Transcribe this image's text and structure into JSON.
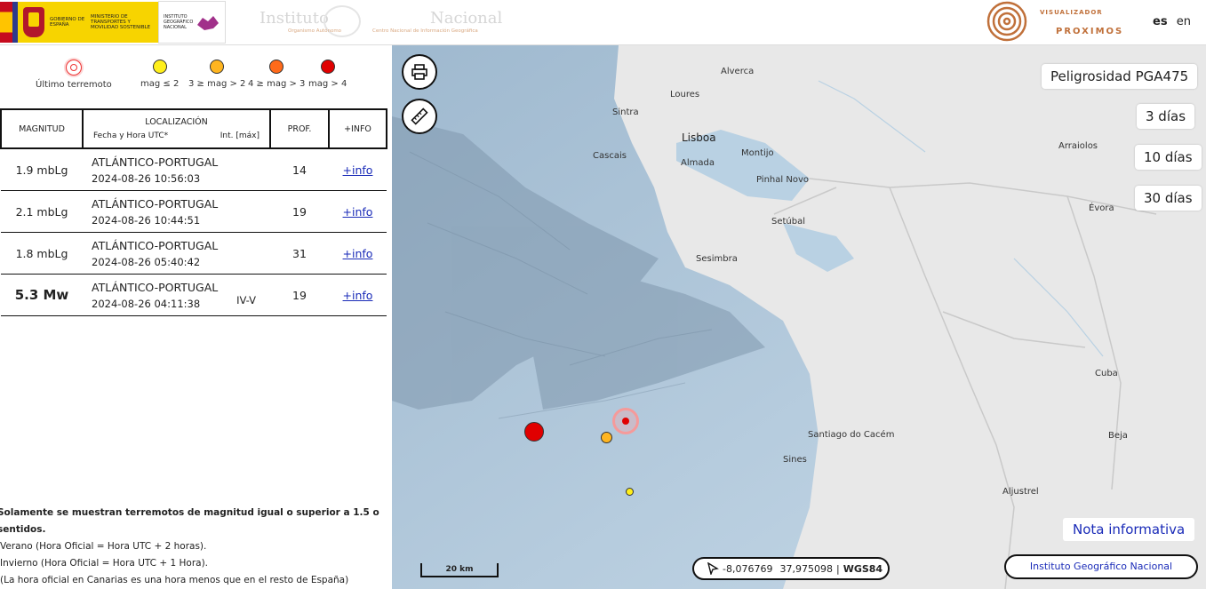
{
  "header": {
    "gobierno_text": "GOBIERNO DE ESPAÑA",
    "ministerio_text": "MINISTERIO DE TRANSPORTES Y MOVILIDAD SOSTENIBLE",
    "ign_small_text": "INSTITUTO GEOGRÁFICO NACIONAL",
    "instituto_title": "Instituto",
    "instituto_sub": "Organismo Autónomo",
    "nacional_title": "Nacional",
    "cnig_sub": "Centro Nacional de Información Geográfica",
    "visualizador": "VISUALIZADOR",
    "proximos": "PROXIMOS",
    "lang_es": "es",
    "lang_en": "en"
  },
  "legend": {
    "last": "Último terremoto",
    "items": [
      {
        "label": "mag ≤ 2",
        "color": "#ffef1a"
      },
      {
        "label": "3 ≥ mag > 2",
        "color": "#ffb520"
      },
      {
        "label": "4 ≥ mag > 3",
        "color": "#ff6a1a"
      },
      {
        "label": "mag > 4",
        "color": "#e00000"
      }
    ]
  },
  "table": {
    "headers": {
      "magnitud": "MAGNITUD",
      "localizacion": "LOCALIZACIÓN",
      "fecha": "Fecha y Hora UTC*",
      "int": "Int. [máx]",
      "prof": "PROF.",
      "info": "+INFO"
    },
    "rows": [
      {
        "mag": "1.9 mbLg",
        "place": "ATLÁNTICO-PORTUGAL",
        "time": "2024-08-26 10:56:03",
        "int": "",
        "prof": "14",
        "info": "+info"
      },
      {
        "mag": "2.1 mbLg",
        "place": "ATLÁNTICO-PORTUGAL",
        "time": "2024-08-26 10:44:51",
        "int": "",
        "prof": "19",
        "info": "+info"
      },
      {
        "mag": "1.8 mbLg",
        "place": "ATLÁNTICO-PORTUGAL",
        "time": "2024-08-26 05:40:42",
        "int": "",
        "prof": "31",
        "info": "+info"
      },
      {
        "mag": "5.3 Mw",
        "place": "ATLÁNTICO-PORTUGAL",
        "time": "2024-08-26 04:11:38",
        "int": "IV-V",
        "prof": "19",
        "info": "+info"
      }
    ]
  },
  "notes": {
    "n0": "Solamente se muestran terremotos de magnitud igual o superior a 1.5 o sentidos.",
    "n1": "Verano (Hora Oficial = Hora UTC + 2 horas).",
    "n2": "Invierno (Hora Oficial = Hora UTC + 1 Hora).",
    "n3": "(La hora oficial en Canarias es una hora menos que en el resto de España)"
  },
  "map": {
    "peligrosidad": "Peligrosidad PGA475",
    "dias3": "3 días",
    "dias10": "10 días",
    "dias30": "30 días",
    "nota": "Nota informativa",
    "scale": "20 km",
    "lon": "-8,076769",
    "lat": "37,975098",
    "datum": "WGS84",
    "ign_link": "Instituto Geográfico Nacional",
    "cities": {
      "alverca": "Alverca",
      "loures": "Loures",
      "sintra": "Sintra",
      "lisboa": "Lisboa",
      "cascais": "Cascais",
      "almada": "Almada",
      "montijo": "Montijo",
      "pinhal": "Pinhal Novo",
      "arraiolos": "Arraiolos",
      "evora": "Évora",
      "setubal": "Setúbal",
      "sesimbra": "Sesimbra",
      "cuba": "Cuba",
      "santiago": "Santiago do Cacém",
      "beja": "Beja",
      "sines": "Sines",
      "aljustrel": "Aljustrel"
    },
    "colors": {
      "sea": "#b8cfe0",
      "land": "#e6e6e6",
      "accent": "#1a2bb8"
    }
  }
}
